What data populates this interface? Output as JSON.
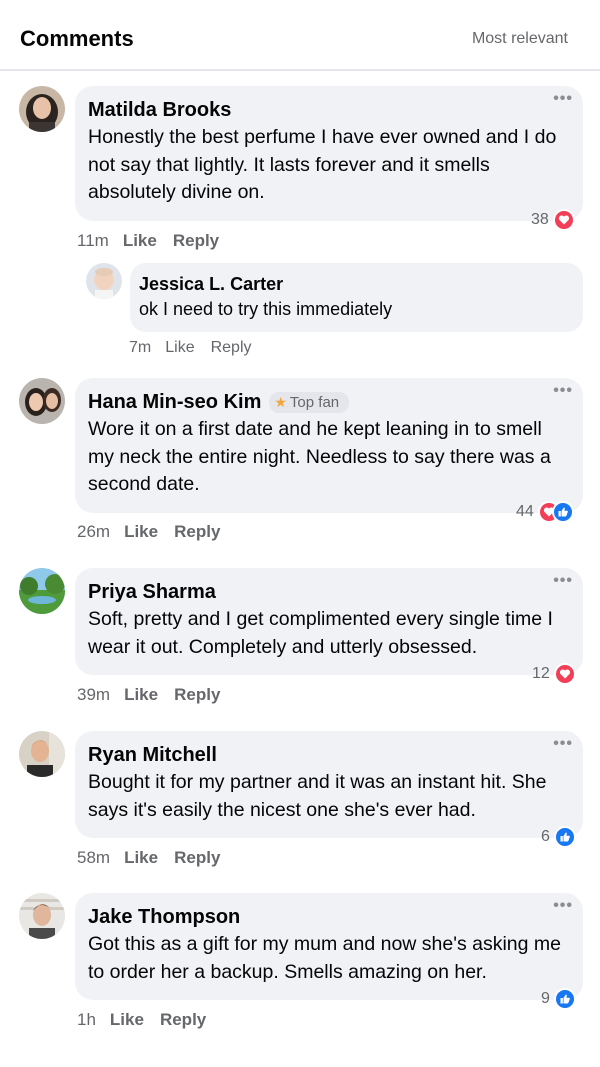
{
  "header": {
    "title": "Comments",
    "sort_label": "Most relevant"
  },
  "comments": [
    {
      "name": "Matilda Brooks",
      "text": "Honestly the best perfume I have ever owned and I do not say that lightly. It lasts forever and it smells absolutely divine on.",
      "reaction_count": "38",
      "reactions": [
        "love"
      ],
      "time": "11m",
      "like_label": "Like",
      "reply_label": "Reply",
      "menu_icon": "more-dots-icon"
    },
    {
      "name": "Jessica L. Carter",
      "text": "ok I need to try this immediately",
      "time": "7m",
      "like_label": "Like",
      "reply_label": "Reply",
      "is_reply": true
    },
    {
      "name": "Hana Min-seo Kim",
      "badge": "Top fan",
      "text": "Wore it on a first date and he kept leaning in to smell my neck the entire night. Needless to say there was a second date.",
      "reaction_count": "44",
      "reactions": [
        "love",
        "like"
      ],
      "time": "26m",
      "like_label": "Like",
      "reply_label": "Reply"
    },
    {
      "name": "Priya Sharma",
      "text": "Soft, pretty and I get complimented every single time I wear it out. Completely and utterly obsessed.",
      "reaction_count": "12",
      "reactions": [
        "love"
      ],
      "time": "39m",
      "like_label": "Like",
      "reply_label": "Reply"
    },
    {
      "name": "Ryan Mitchell",
      "text": "Bought it for my partner and it was an instant hit. She says it's easily the nicest one she's ever had.",
      "reaction_count": "6",
      "reactions": [
        "like"
      ],
      "time": "58m",
      "like_label": "Like",
      "reply_label": "Reply"
    },
    {
      "name": "Jake Thompson",
      "text": "Got this as a gift for my mum and now she's asking me to order her a backup. Smells amazing on her.",
      "reaction_count": "9",
      "reactions": [
        "like"
      ],
      "time": "1h",
      "like_label": "Like",
      "reply_label": "Reply"
    }
  ],
  "colors": {
    "love": "#f33e58",
    "like": "#1877f2",
    "bubble": "#f0f2f5",
    "muted": "#65676b",
    "top_fan_star": "#f0a63a"
  },
  "icons": {
    "love": "heart-icon",
    "like": "thumbs-up-icon",
    "more": "more-dots-icon",
    "star": "star-icon"
  }
}
